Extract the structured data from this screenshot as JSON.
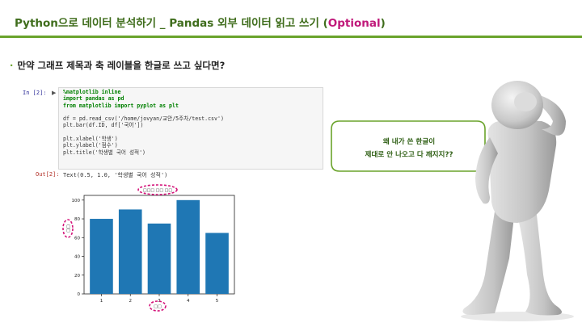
{
  "header": {
    "title_main": "Python으로 데이터 분석하기 _ Pandas 외부 데이터 읽고 쓰기 (",
    "title_optional": "Optional",
    "title_close": ")",
    "accent_color": "#6aa32b",
    "title_color": "#3f6d1c",
    "optional_color": "#c0197a"
  },
  "bullet": {
    "text": "만약 그래프 제목과 축 레이블을 한글로 쓰고 싶다면?"
  },
  "notebook": {
    "in_prompt": "In [2]:",
    "run_icon": "run-icon",
    "code_lines": [
      "%matplotlib inline",
      "import pandas as pd",
      "from matplotlib import pyplot as plt",
      "",
      "df = pd.read_csv('/home/jovyan/교안/5주차/test.csv')",
      "plt.bar(df.ID, df['국어'])",
      "",
      "plt.xlabel('학생')",
      "plt.ylabel('점수')",
      "plt.title('학생별 국어 성적')"
    ],
    "out_prompt": "Out[2]:",
    "out_text": "Text(0.5, 1.0, '학생별 국어 성적')"
  },
  "chart_data": {
    "type": "bar",
    "categories": [
      "1",
      "2",
      "3",
      "4",
      "5"
    ],
    "values": [
      80,
      90,
      75,
      100,
      65
    ],
    "ylim": [
      0,
      105
    ],
    "yticks": [
      "0",
      "20",
      "40",
      "60",
      "80",
      "100"
    ],
    "bar_color": "#1f77b4",
    "title": "□□□ □□ □□",
    "xlabel": "□□",
    "ylabel": "□□",
    "highlight_color": "#d4147a"
  },
  "bubble": {
    "line1": "왜 내가 쓴 한글이",
    "line2": "제대로 안 나오고 다 깨지지??",
    "border_color": "#6aa32b"
  }
}
